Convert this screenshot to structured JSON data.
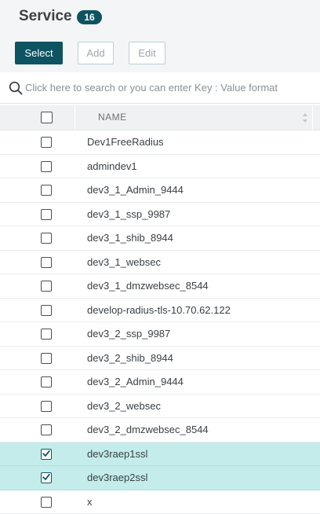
{
  "header": {
    "title": "Service",
    "count": "16"
  },
  "toolbar": {
    "select_label": "Select",
    "add_label": "Add",
    "edit_label": "Edit"
  },
  "search": {
    "placeholder": "Click here to search or you can enter Key : Value format",
    "value": ""
  },
  "table": {
    "columns": [
      "NAME"
    ],
    "rows": [
      {
        "name": "Dev1FreeRadius",
        "checked": false
      },
      {
        "name": "admindev1",
        "checked": false
      },
      {
        "name": "dev3_1_Admin_9444",
        "checked": false
      },
      {
        "name": "dev3_1_ssp_9987",
        "checked": false
      },
      {
        "name": "dev3_1_shib_8944",
        "checked": false
      },
      {
        "name": "dev3_1_websec",
        "checked": false
      },
      {
        "name": "dev3_1_dmzwebsec_8544",
        "checked": false
      },
      {
        "name": "develop-radius-tls-10.70.62.122",
        "checked": false
      },
      {
        "name": "dev3_2_ssp_9987",
        "checked": false
      },
      {
        "name": "dev3_2_shib_8944",
        "checked": false
      },
      {
        "name": "dev3_2_Admin_9444",
        "checked": false
      },
      {
        "name": "dev3_2_websec",
        "checked": false
      },
      {
        "name": "dev3_2_dmzwebsec_8544",
        "checked": false
      },
      {
        "name": "dev3raep1ssl",
        "checked": true
      },
      {
        "name": "dev3raep2ssl",
        "checked": true
      },
      {
        "name": "x",
        "checked": false
      }
    ]
  },
  "colors": {
    "accent": "#0e5361",
    "selected_row": "#c3ecea"
  },
  "icons": {
    "search": "search-icon",
    "sort": "sort-icon",
    "check": "check-icon"
  }
}
